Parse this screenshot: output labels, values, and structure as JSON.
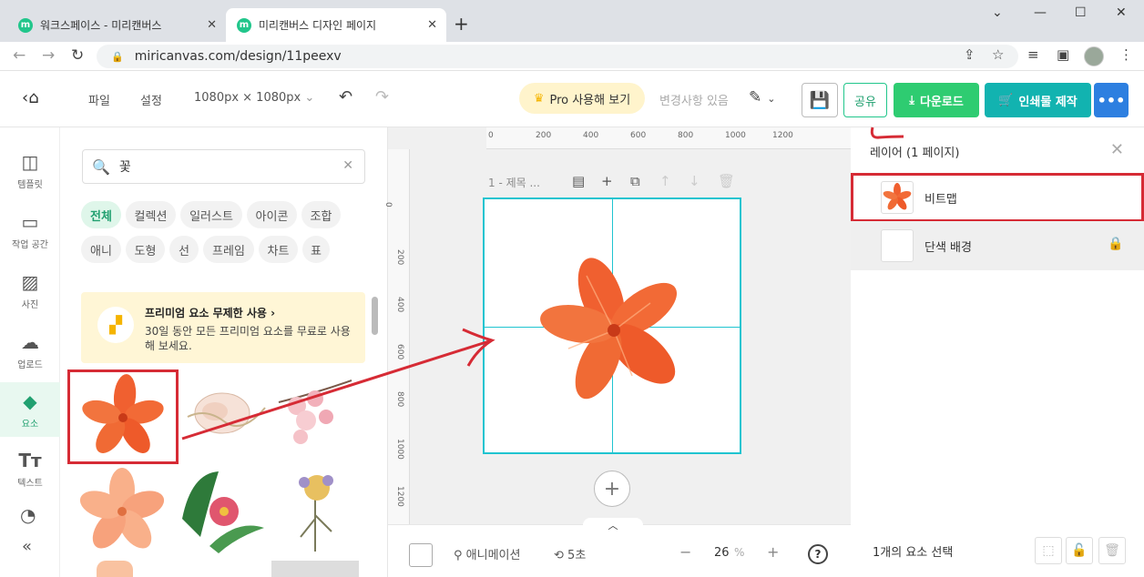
{
  "browser": {
    "tabs": [
      {
        "title": "워크스페이스 - 미리캔버스",
        "favicon": "m"
      },
      {
        "title": "미리캔버스 디자인 페이지",
        "favicon": "m"
      }
    ],
    "url": "miricanvas.com/design/11peexv"
  },
  "toolbar": {
    "file": "파일",
    "settings": "설정",
    "size": "1080px × 1080px",
    "pro": "Pro 사용해 보기",
    "changes": "변경사항 있음",
    "share": "공유",
    "download": "다운로드",
    "print": "인쇄물 제작",
    "more": "•••"
  },
  "rail": [
    {
      "label": "템플릿",
      "icon": "template-icon"
    },
    {
      "label": "작업 공간",
      "icon": "workspace-icon"
    },
    {
      "label": "사진",
      "icon": "photo-icon"
    },
    {
      "label": "업로드",
      "icon": "upload-icon"
    },
    {
      "label": "요소",
      "icon": "elements-icon"
    },
    {
      "label": "텍스트",
      "icon": "text-icon"
    }
  ],
  "panel": {
    "search_value": "꽃",
    "chips_row1": [
      "전체",
      "컬렉션",
      "일러스트",
      "아이콘",
      "조합"
    ],
    "chips_row2": [
      "애니",
      "도형",
      "선",
      "프레임",
      "차트",
      "표"
    ],
    "promo_title": "프리미엄 요소 무제한 사용",
    "promo_desc": "30일 동안 모든 프리미엄 요소를 무료로 사용해 보세요."
  },
  "canvas": {
    "page_label": "1 - 제목 ...",
    "hruler": [
      "0",
      "200",
      "400",
      "600",
      "800",
      "1000",
      "1200"
    ],
    "vruler": [
      "0",
      "200",
      "400",
      "600",
      "800",
      "1000",
      "1200"
    ]
  },
  "bottom": {
    "animation": "애니메이션",
    "duration": "5초",
    "zoom": "26",
    "zoom_unit": "%",
    "help": "?"
  },
  "layers": {
    "header": "레이어 (1 페이지)",
    "items": [
      {
        "name": "비트맵"
      },
      {
        "name": "단색 배경"
      }
    ],
    "selected": "1개의 요소 선택"
  },
  "colors": {
    "brand": "#21c68b",
    "download": "#2ecc71",
    "print": "#12b3b0",
    "more": "#2d7fe0",
    "annotation": "#d62b35",
    "guide": "#1fc4d0",
    "flower": "#f06030"
  }
}
